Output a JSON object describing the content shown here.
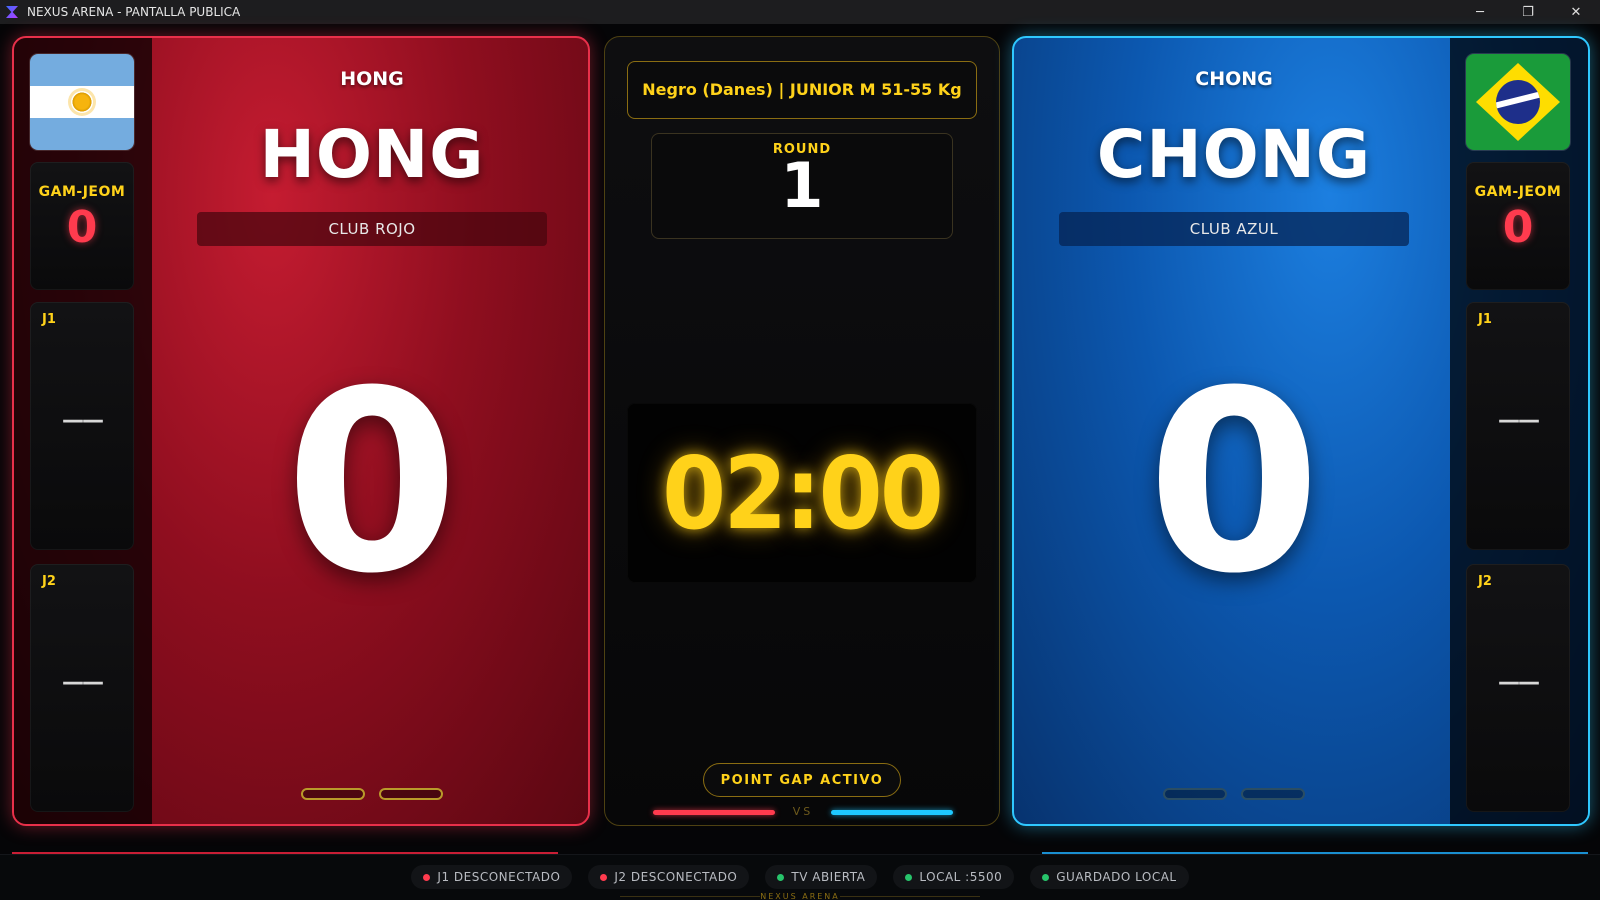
{
  "window": {
    "title": "NEXUS ARENA - PANTALLA PUBLICA",
    "controls": {
      "minimize": "─",
      "restore": "❐",
      "close": "✕"
    }
  },
  "red": {
    "flag_icon": "argentina-flag-icon",
    "small_name": "HONG",
    "name": "HONG",
    "club": "CLUB ROJO",
    "score": "0",
    "gam_jeom_label": "GAM-JEOM",
    "gam_jeom": "0",
    "j1_label": "J1",
    "j1_value": "——",
    "j2_label": "J2",
    "j2_value": "——",
    "accent": "#e8304a"
  },
  "blue": {
    "flag_icon": "brazil-flag-icon",
    "small_name": "CHONG",
    "name": "CHONG",
    "club": "CLUB AZUL",
    "score": "0",
    "gam_jeom_label": "GAM-JEOM",
    "gam_jeom": "0",
    "j1_label": "J1",
    "j1_value": "——",
    "j2_label": "J2",
    "j2_value": "——",
    "accent": "#2fc8ff"
  },
  "center": {
    "category": "Negro (Danes) | JUNIOR M 51-55 Kg",
    "round_label": "ROUND",
    "round": "1",
    "timer": "02:00",
    "point_gap": "POINT GAP ACTIVO",
    "vs": "VS",
    "accent": "#ffd21a"
  },
  "status": {
    "items": [
      {
        "label": "J1 DESCONECTADO",
        "color": "#ff3b4e"
      },
      {
        "label": "J2 DESCONECTADO",
        "color": "#ff3b4e"
      },
      {
        "label": "TV ABIERTA",
        "color": "#27c46b"
      },
      {
        "label": "LOCAL :5500",
        "color": "#27c46b"
      },
      {
        "label": "GUARDADO LOCAL",
        "color": "#27c46b"
      }
    ],
    "brand": "NEXUS ARENA"
  }
}
